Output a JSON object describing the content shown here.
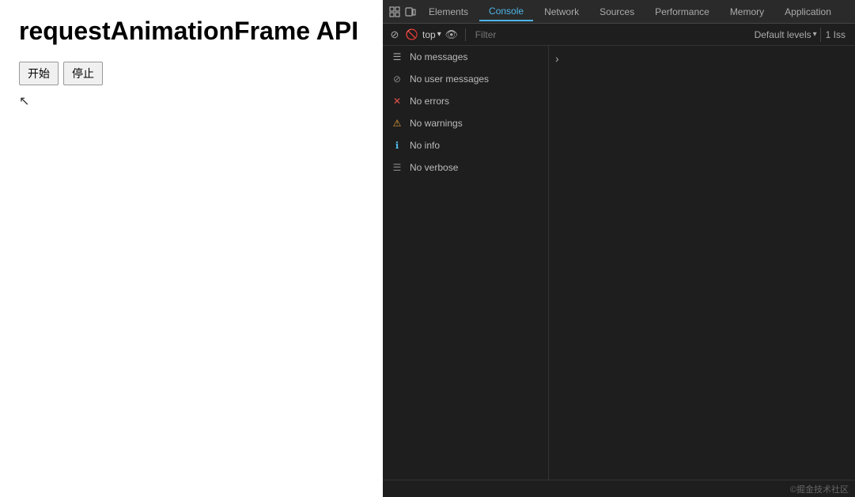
{
  "left": {
    "title": "requestAnimationFrame API",
    "btn_start": "开始",
    "btn_stop": "停止"
  },
  "devtools": {
    "tabs": [
      {
        "label": "Elements",
        "active": false
      },
      {
        "label": "Console",
        "active": true
      },
      {
        "label": "Network",
        "active": false
      },
      {
        "label": "Sources",
        "active": false
      },
      {
        "label": "Performance",
        "active": false
      },
      {
        "label": "Memory",
        "active": false
      },
      {
        "label": "Application",
        "active": false
      }
    ],
    "toolbar2": {
      "top_label": "top",
      "filter_placeholder": "Filter",
      "default_levels": "Default levels",
      "issue_count": "1 Iss"
    },
    "console_items": [
      {
        "icon": "messages",
        "label": "No messages",
        "icon_char": "☰"
      },
      {
        "icon": "user",
        "label": "No user messages",
        "icon_char": "⊘"
      },
      {
        "icon": "error",
        "label": "No errors",
        "icon_char": "✕"
      },
      {
        "icon": "warning",
        "label": "No warnings",
        "icon_char": "⚠"
      },
      {
        "icon": "info",
        "label": "No info",
        "icon_char": "ℹ"
      },
      {
        "icon": "verbose",
        "label": "No verbose",
        "icon_char": "☰"
      }
    ],
    "branding": "©掘金技术社区"
  }
}
